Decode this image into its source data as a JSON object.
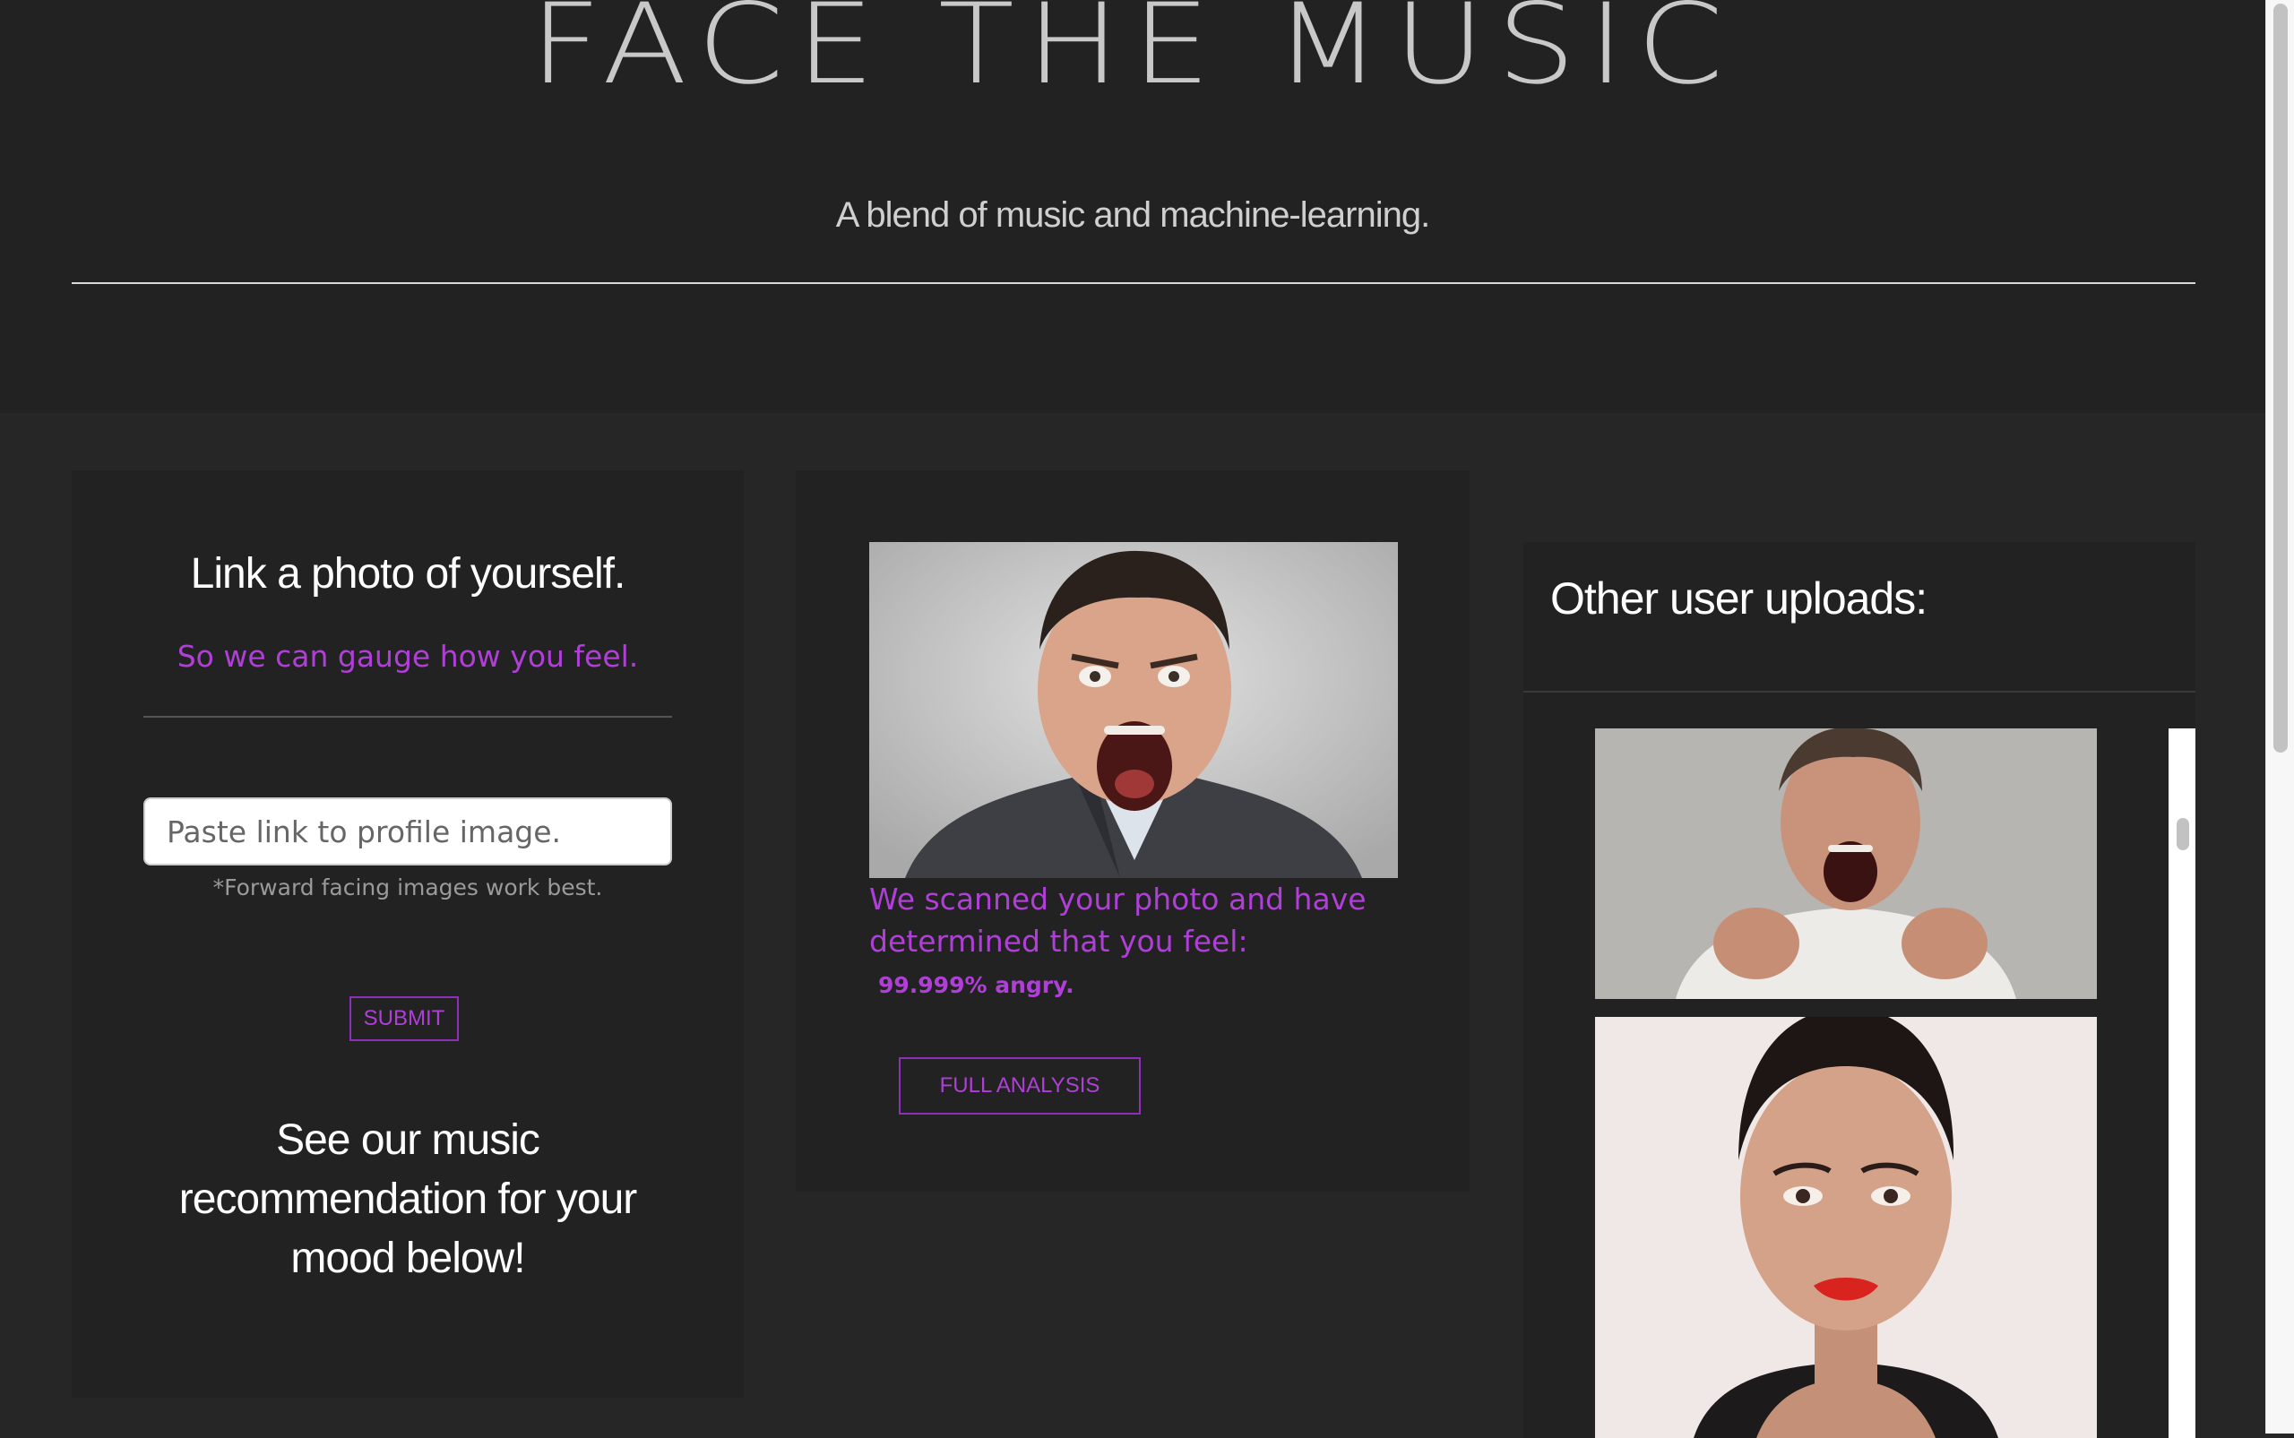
{
  "header": {
    "title": "FACE THE MUSIC",
    "tagline": "A blend of music and machine-learning."
  },
  "upload_card": {
    "heading": "Link a photo of yourself.",
    "subheading": "So we can gauge how you feel.",
    "input_placeholder": "Paste link to profile image.",
    "input_value": "",
    "hint": "*Forward facing images work best.",
    "submit_label": "SUBMIT",
    "recommendation_text": "See our music recommendation for your mood below!"
  },
  "result_card": {
    "scan_text": "We scanned your photo and have determined that you feel:",
    "result": "99.999% angry.",
    "analysis_label": "FULL ANALYSIS"
  },
  "uploads_panel": {
    "title": "Other user uploads:"
  },
  "colors": {
    "accent": "#b03fd8",
    "background": "#262626",
    "card": "#222222"
  }
}
